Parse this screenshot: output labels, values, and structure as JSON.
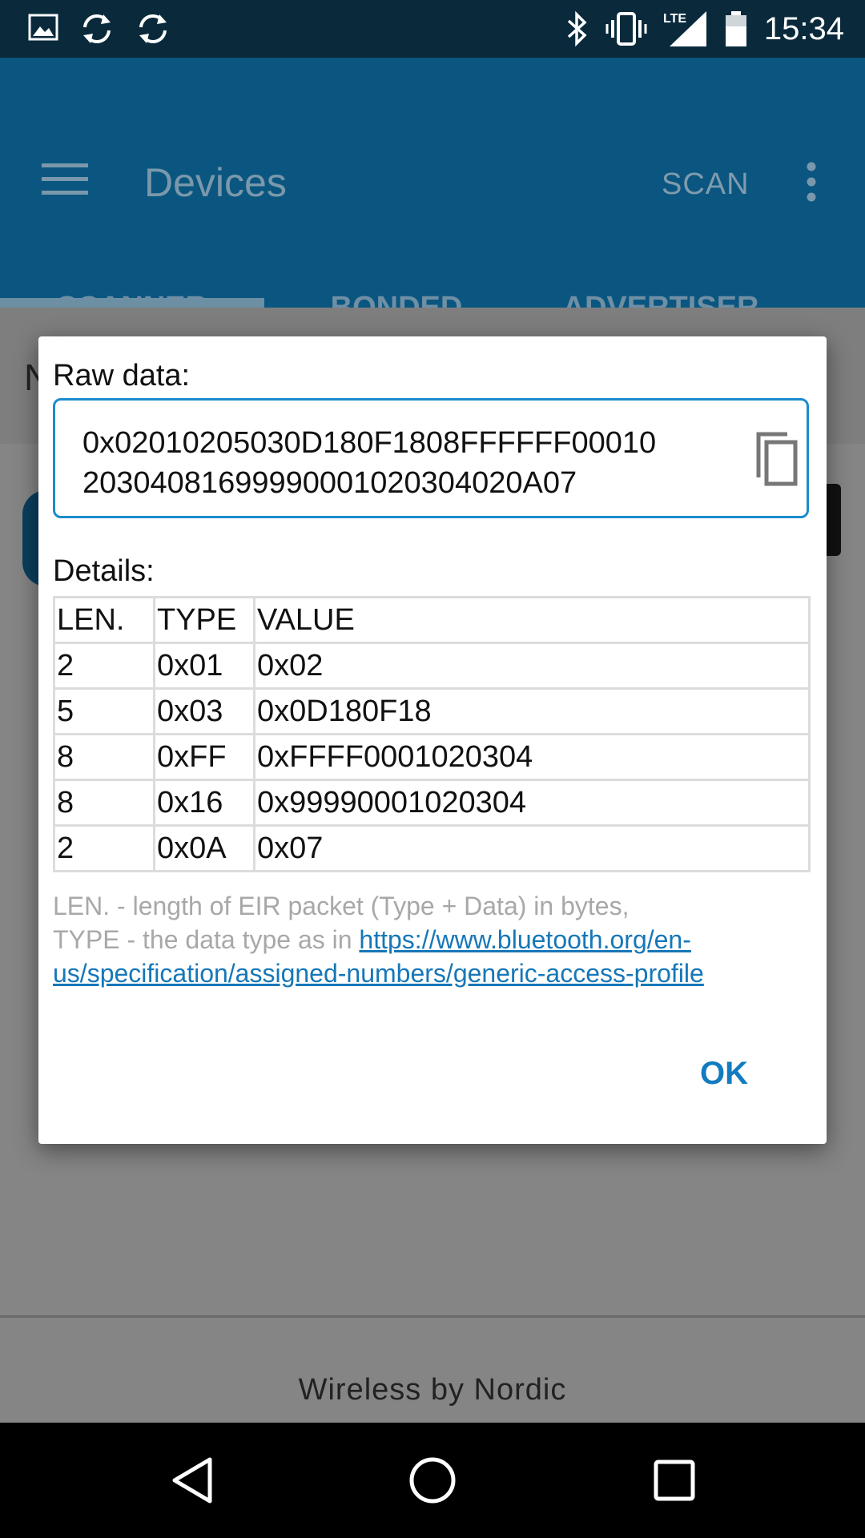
{
  "status_bar": {
    "time": "15:34",
    "left_icons": [
      "image-icon",
      "sync-icon",
      "sync-icon"
    ],
    "right_icons": [
      "bluetooth-icon",
      "vibrate-icon",
      "lte-signal-icon",
      "battery-icon"
    ],
    "network": "LTE"
  },
  "app_bar": {
    "title": "Devices",
    "scan_label": "SCAN",
    "tabs": [
      {
        "label": "SCANNER",
        "selected": true
      },
      {
        "label": "BONDED",
        "selected": false
      },
      {
        "label": "ADVERTISER",
        "selected": false
      }
    ]
  },
  "background": {
    "row_letter": "N",
    "footer": "Wireless by Nordic"
  },
  "dialog": {
    "raw_label": "Raw data:",
    "raw_value": "0x02010205030D180F1808FFFFFF000102030408169999000102030402 0A07",
    "raw_lines": [
      "0x02010205030D180F1808FFFFFF00010",
      "20304081699990001020304020A07"
    ],
    "details_label": "Details:",
    "columns": [
      "LEN.",
      "TYPE",
      "VALUE"
    ],
    "rows": [
      [
        "2",
        "0x01",
        "0x02"
      ],
      [
        "5",
        "0x03",
        "0x0D180F18"
      ],
      [
        "8",
        "0xFF",
        "0xFFFF0001020304"
      ],
      [
        "8",
        "0x16",
        "0x99990001020304"
      ],
      [
        "2",
        "0x0A",
        "0x07"
      ]
    ],
    "note_line1": "LEN. - length of EIR packet (Type + Data) in bytes,",
    "note_line2_prefix": "TYPE - the data type as in ",
    "note_link": "https://www.bluetooth.org/en-us/specification/assigned-numbers/generic-access-profile",
    "ok_label": "OK"
  },
  "colors": {
    "status_bar": "#0a2a3c",
    "app_bar": "#0a5680",
    "accent": "#1c8ccd",
    "link": "#1677b8"
  }
}
